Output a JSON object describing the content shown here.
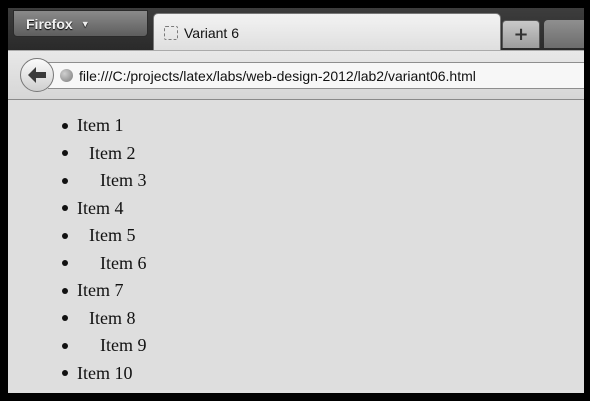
{
  "browser": {
    "menu_button_label": "Firefox",
    "new_tab_label": "+"
  },
  "tab": {
    "title": "Variant 6"
  },
  "navbar": {
    "url": "file:///C:/projects/latex/labs/web-design-2012/lab2/variant06.html"
  },
  "list": {
    "items": [
      {
        "label": "Item 1",
        "indent": 0
      },
      {
        "label": "Item 2",
        "indent": 1
      },
      {
        "label": "Item 3",
        "indent": 2
      },
      {
        "label": "Item 4",
        "indent": 0
      },
      {
        "label": "Item 5",
        "indent": 1
      },
      {
        "label": "Item 6",
        "indent": 2
      },
      {
        "label": "Item 7",
        "indent": 0
      },
      {
        "label": "Item 8",
        "indent": 1
      },
      {
        "label": "Item 9",
        "indent": 2
      },
      {
        "label": "Item 10",
        "indent": 0
      }
    ]
  }
}
